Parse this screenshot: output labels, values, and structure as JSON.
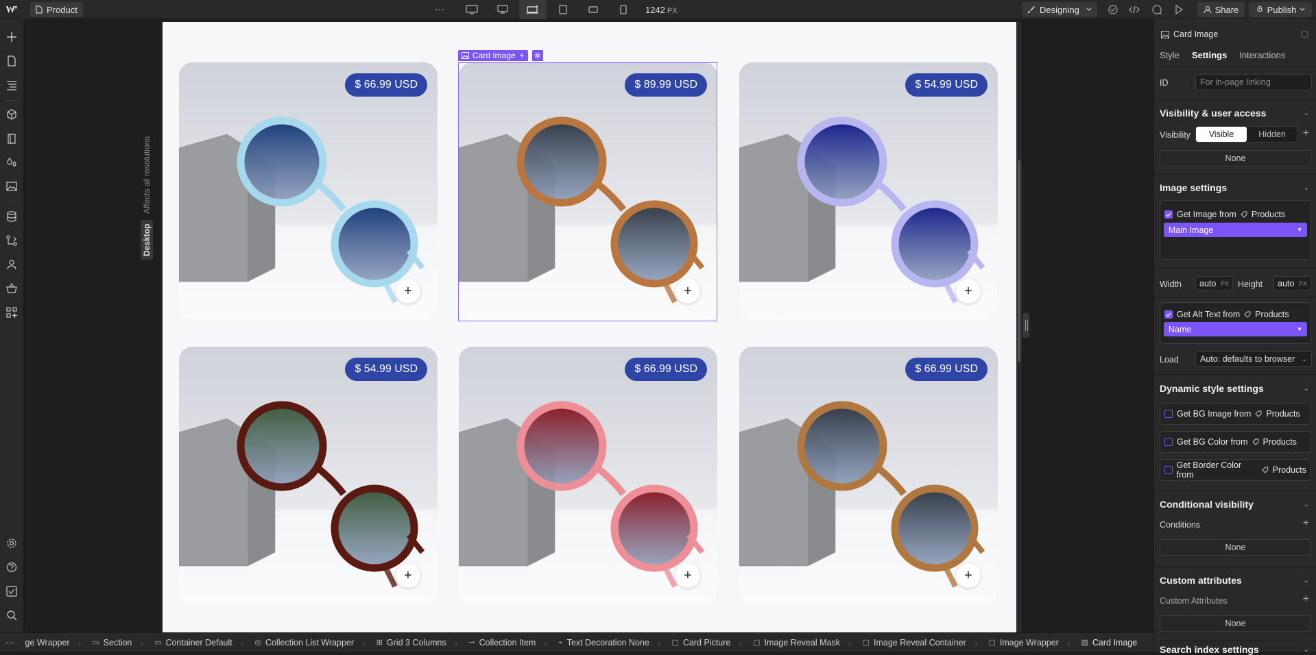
{
  "topbar": {
    "page_name": "Product",
    "more": "⋯",
    "px_value": "1242",
    "px_unit": "PX",
    "mode": "Designing",
    "share": "Share",
    "publish": "Publish"
  },
  "canvas": {
    "affects_text": "Affects all resolutions",
    "breakpoint_tag": "Desktop",
    "selected_label": "Card Image",
    "products": [
      {
        "price": "$ 66.99 USD",
        "frame": "#a7d9ee",
        "lens": "#1b3c7a"
      },
      {
        "price": "$ 89.99 USD",
        "frame": "#b9773f",
        "lens": "#333b46"
      },
      {
        "price": "$ 54.99 USD",
        "frame": "#b8b6f0",
        "lens": "#16208a"
      },
      {
        "price": "$ 54.99 USD",
        "frame": "#5a1a12",
        "lens": "#3d5a3b"
      },
      {
        "price": "$ 66.99 USD",
        "frame": "#ee8f98",
        "lens": "#8a1a25"
      },
      {
        "price": "$ 66.99 USD",
        "frame": "#b0773e",
        "lens": "#333a46"
      }
    ],
    "add_symbol": "+"
  },
  "panel": {
    "title": "Card Image",
    "tabs": [
      "Style",
      "Settings",
      "Interactions"
    ],
    "id_label": "ID",
    "id_placeholder": "For in-page linking",
    "visibility_section": "Visibility & user access",
    "visibility_label": "Visibility",
    "visible": "Visible",
    "hidden": "Hidden",
    "visibility_none": "None",
    "image_settings": "Image settings",
    "get_image_prefix": "Get Image from",
    "collection": "Products",
    "main_image": "Main Image",
    "width_label": "Width",
    "width_value": "auto",
    "height_label": "Height",
    "height_value": "auto",
    "unit": "PX",
    "get_alt_prefix": "Get Alt Text from",
    "alt_field": "Name",
    "load_label": "Load",
    "load_value": "Auto: defaults to browser",
    "dynamic_section": "Dynamic style settings",
    "bg_image": "Get BG Image from",
    "bg_color": "Get BG Color from",
    "border_color": "Get Border Color from",
    "conditional_section": "Conditional visibility",
    "conditions_label": "Conditions",
    "conditions_none": "None",
    "custom_attr_section": "Custom attributes",
    "custom_attr_label": "Custom Attributes",
    "custom_attr_none": "None",
    "search_section": "Search index settings"
  },
  "breadcrumbs": [
    "ge Wrapper",
    "Section",
    "Container Default",
    "Collection List Wrapper",
    "Grid 3 Columns",
    "Collection Item",
    "Text Decoration None",
    "Card Picture",
    "Image Reveal Mask",
    "Image Reveal Container",
    "Image Wrapper",
    "Card Image"
  ]
}
